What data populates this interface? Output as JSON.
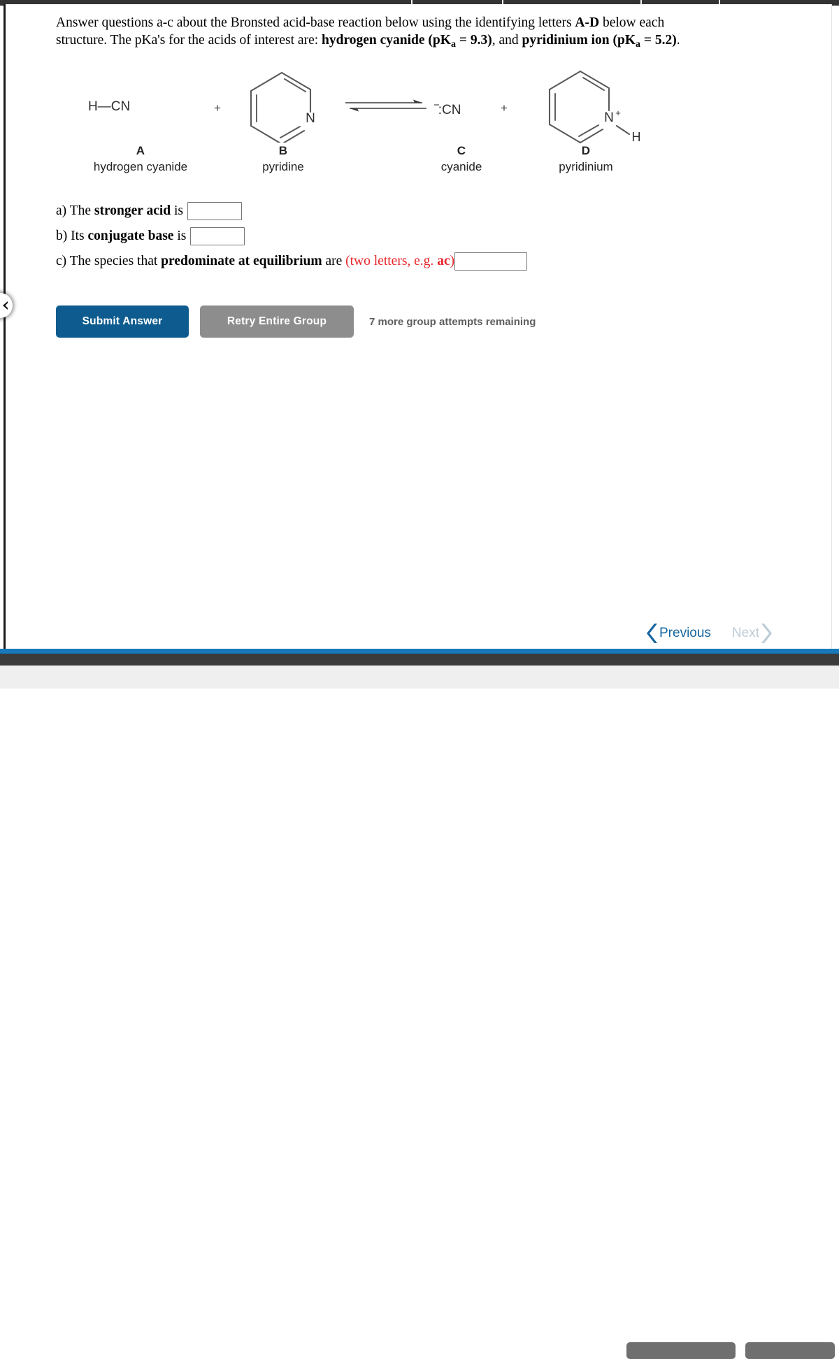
{
  "window": {
    "top_bar_color": "#333333",
    "bottom_accent_color": "#1779ba",
    "bottom_bar_color": "#3b3b3b"
  },
  "collapse_handle": {
    "icon": "chevron-left-icon"
  },
  "prompt": {
    "line1_a": "Answer questions a-c about the Bronsted acid-base reaction below using the identifying letters ",
    "line1_b": "A-D",
    "line1_c": " below each",
    "line2_a": "structure. The pKa's for the acids of interest are: ",
    "line2_b": "hydrogen cyanide (pK",
    "line2_sub1": "a",
    "line2_c": " = 9.3)",
    "line2_d": ", and ",
    "line2_e": "pyridinium ion (pK",
    "line2_sub2": "a",
    "line2_f": " = 5.2)",
    "line2_g": "."
  },
  "scheme": {
    "reactants": [
      {
        "letter": "A",
        "name": "hydrogen cyanide",
        "formula": "H—CN",
        "kind": "formula"
      },
      {
        "letter": "B",
        "name": "pyridine",
        "kind": "pyridine-ring"
      }
    ],
    "products": [
      {
        "letter": "C",
        "name": "cyanide",
        "formula": ":CN",
        "charge": "−",
        "kind": "anion-formula"
      },
      {
        "letter": "D",
        "name": "pyridinium",
        "kind": "pyridinium-ring",
        "n_label": "N",
        "n_charge": "+",
        "h_label": "H"
      }
    ],
    "plus_sign": "+",
    "arrow_name": "equilibrium-arrows"
  },
  "questions": [
    {
      "id": "a",
      "prefix": "a) The ",
      "bold": "stronger acid",
      "suffix": " is",
      "value": "",
      "hint": ""
    },
    {
      "id": "b",
      "prefix": "b) Its ",
      "bold": "conjugate base",
      "suffix": " is",
      "value": "",
      "hint": ""
    },
    {
      "id": "c",
      "prefix": "c) The species that ",
      "bold": "predominate at equilibrium",
      "suffix": " are ",
      "hint_prefix": "(two letters, e.g. ",
      "hint_bold": "ac",
      "hint_suffix": ")",
      "value": ""
    }
  ],
  "actions": {
    "submit_label": "Submit Answer",
    "retry_label": "Retry Entire Group",
    "attempts_text": "7 more group attempts remaining",
    "submit_color": "#0e5c8f",
    "retry_color": "#8d8d8d"
  },
  "pager": {
    "previous_label": "Previous",
    "next_label": "Next",
    "previous_color": "#1565a0",
    "next_color": "#bcccd6"
  }
}
